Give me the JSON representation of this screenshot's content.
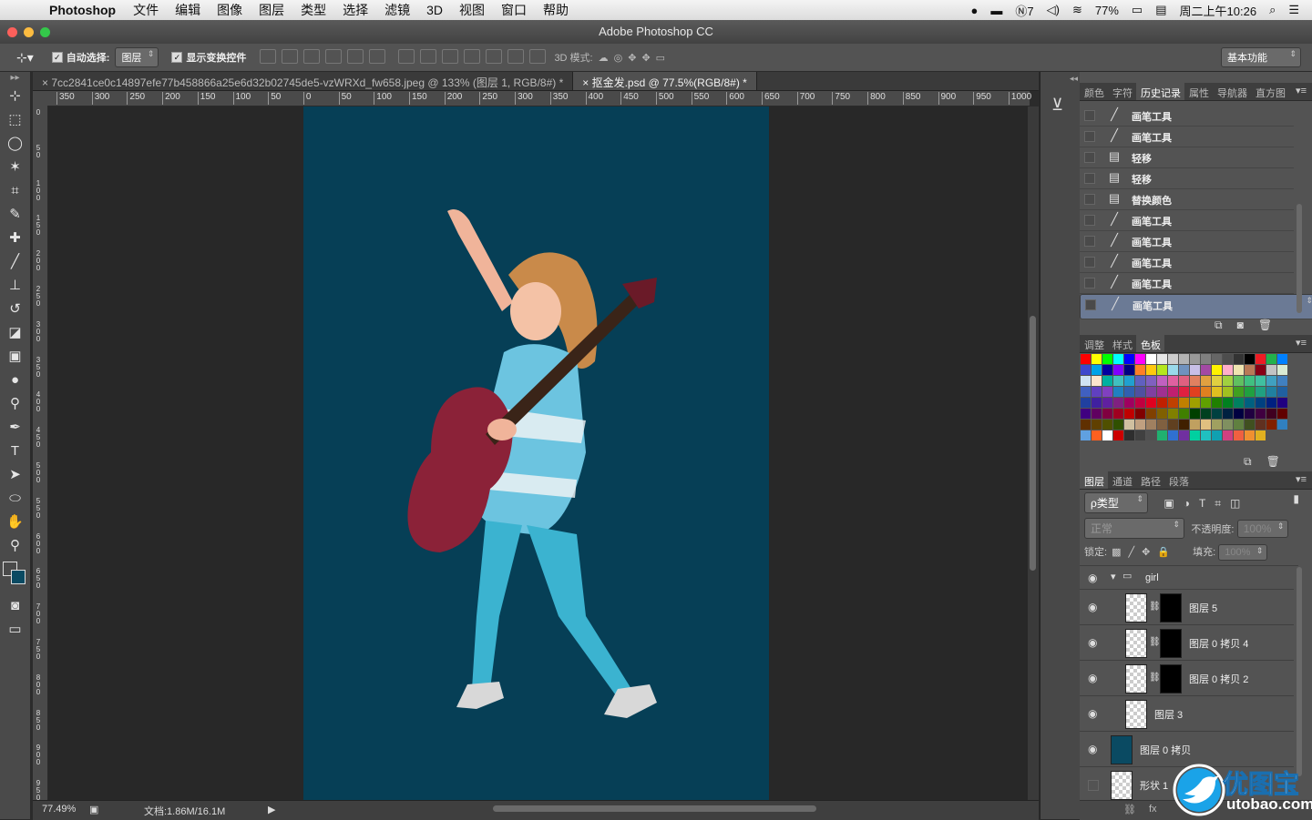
{
  "menubar": {
    "app_name": "Photoshop",
    "items": [
      "文件",
      "编辑",
      "图像",
      "图层",
      "类型",
      "选择",
      "滤镜",
      "3D",
      "视图",
      "窗口",
      "帮助"
    ],
    "status": {
      "input_method": "7",
      "battery": "77%",
      "datetime": "周二上午10:26"
    }
  },
  "window": {
    "title": "Adobe Photoshop CC"
  },
  "options": {
    "auto_select_label": "自动选择:",
    "auto_select_value": "图层",
    "show_transform_label": "显示变换控件",
    "mode_3d_label": "3D 模式:",
    "workspace": "基本功能"
  },
  "tabs": [
    {
      "label": "7cc2841ce0c14897efe77b458866a25e6d32b02745de5-vzWRXd_fw658.jpeg @ 133% (图层 1, RGB/8#) *"
    },
    {
      "label": "抠金发.psd @ 77.5%(RGB/8#) *"
    }
  ],
  "ruler": {
    "h_ticks": [
      "350",
      "300",
      "250",
      "200",
      "150",
      "100",
      "50",
      "0",
      "50",
      "100",
      "150",
      "200",
      "250",
      "300",
      "350",
      "400",
      "450",
      "500",
      "550",
      "600",
      "650",
      "700",
      "750",
      "800",
      "850",
      "900",
      "950",
      "1000"
    ],
    "v_ticks": [
      "0",
      "5\n0",
      "1\n0\n0",
      "1\n5\n0",
      "2\n0\n0",
      "2\n5\n0",
      "3\n0\n0",
      "3\n5\n0",
      "4\n0\n0",
      "4\n5\n0",
      "5\n0\n0",
      "5\n5\n0",
      "6\n0\n0",
      "6\n5\n0",
      "7\n0\n0",
      "7\n5\n0",
      "8\n0\n0",
      "8\n5\n0",
      "9\n0\n0",
      "9\n5\n0"
    ]
  },
  "status": {
    "zoom": "77.49%",
    "doc_size": "文档:1.86M/16.1M"
  },
  "history_panel": {
    "tabs": [
      "颜色",
      "字符",
      "历史记录",
      "属性",
      "导航器",
      "直方图"
    ],
    "active_tab": "历史记录",
    "items": [
      {
        "label": "画笔工具",
        "icon": "brush-icon"
      },
      {
        "label": "画笔工具",
        "icon": "brush-icon"
      },
      {
        "label": "轻移",
        "icon": "document-icon"
      },
      {
        "label": "轻移",
        "icon": "document-icon"
      },
      {
        "label": "替换颜色",
        "icon": "document-icon"
      },
      {
        "label": "画笔工具",
        "icon": "brush-icon"
      },
      {
        "label": "画笔工具",
        "icon": "brush-icon"
      },
      {
        "label": "画笔工具",
        "icon": "brush-icon"
      },
      {
        "label": "画笔工具",
        "icon": "brush-icon"
      },
      {
        "label": "画笔工具",
        "icon": "brush-icon",
        "selected": true
      }
    ]
  },
  "swatches_panel": {
    "tabs": [
      "调整",
      "样式",
      "色板"
    ],
    "active_tab": "色板",
    "colors": [
      "#ff0000",
      "#ffff00",
      "#00ff00",
      "#00ffff",
      "#0000ff",
      "#ff00ff",
      "#ffffff",
      "#e6e6e6",
      "#cccccc",
      "#b3b3b3",
      "#999999",
      "#808080",
      "#666666",
      "#4d4d4d",
      "#333333",
      "#000000",
      "#ed1c24",
      "#22b14c",
      "#0080ff",
      "#3f48cc",
      "#00a2e8",
      "#0000a0",
      "#7f00ff",
      "#000080",
      "#ff7f27",
      "#ffc90e",
      "#b5e61d",
      "#99d9ea",
      "#7092be",
      "#c8bfe7",
      "#a349a4",
      "#fff200",
      "#ffaec9",
      "#efe4b0",
      "#b97a57",
      "#880015",
      "#c3c3c3",
      "#d9ead3",
      "#cfe2f3",
      "#fce5cd",
      "#00b0a0",
      "#40c0c0",
      "#20a0d0",
      "#6060c0",
      "#8060c0",
      "#c060c0",
      "#e060a0",
      "#e06080",
      "#e08060",
      "#e0a040",
      "#e0d040",
      "#a0d040",
      "#60c060",
      "#40c080",
      "#40c0a0",
      "#40a0c0",
      "#4080c0",
      "#4060c0",
      "#6040c0",
      "#8040c0",
      "#2080c0",
      "#3060b0",
      "#5050a0",
      "#8040a0",
      "#a03090",
      "#c02070",
      "#e02040",
      "#e04020",
      "#e08020",
      "#e0c020",
      "#a0c020",
      "#40a020",
      "#20a040",
      "#20a080",
      "#2080a0",
      "#2060a0",
      "#2040a0",
      "#4020a0",
      "#6020a0",
      "#802080",
      "#a00060",
      "#c00040",
      "#e00020",
      "#c02000",
      "#c04000",
      "#c08000",
      "#a0a000",
      "#60a000",
      "#208000",
      "#008020",
      "#008060",
      "#006080",
      "#004080",
      "#002080",
      "#200080",
      "#400080",
      "#600060",
      "#800040",
      "#a00020",
      "#c00000",
      "#800000",
      "#804000",
      "#806000",
      "#808000",
      "#408000",
      "#004000",
      "#004020",
      "#004040",
      "#002040",
      "#000040",
      "#200040",
      "#400040",
      "#400020",
      "#600000",
      "#603000",
      "#604000",
      "#505000",
      "#305000",
      "#d0c0a0",
      "#c0a080",
      "#a08060",
      "#806040",
      "#604020",
      "#402000",
      "#c0a060",
      "#e0c080",
      "#a0a060",
      "#809060",
      "#608040",
      "#405020",
      "#603020",
      "#802000",
      "#3080c0",
      "#60a0e0",
      "#ff6020",
      "#ffffff",
      "#cc0000",
      "#2e2e2e",
      "#404040",
      "#505050",
      "#20b070",
      "#3070d0",
      "#7030a0",
      "#00d0a0",
      "#20c0c0",
      "#10a0b0",
      "#d04080",
      "#f06040",
      "#f09030",
      "#e0b020"
    ]
  },
  "layers_panel": {
    "tabs": [
      "图层",
      "通道",
      "路径",
      "段落"
    ],
    "active_tab": "图层",
    "filter": "ρ类型",
    "blend_mode": "正常",
    "opacity_label": "不透明度:",
    "opacity": "100%",
    "lock_label": "锁定:",
    "fill_label": "填充:",
    "fill": "100%",
    "layers": [
      {
        "name": "girl",
        "type": "group"
      },
      {
        "name": "图层 5",
        "type": "masked"
      },
      {
        "name": "图层 0 拷贝 4",
        "type": "masked"
      },
      {
        "name": "图层 0 拷贝 2",
        "type": "masked"
      },
      {
        "name": "图层 3",
        "type": "plain"
      },
      {
        "name": "图层 0 拷贝",
        "type": "fill",
        "color": "#0a4a62"
      },
      {
        "name": "形状 1",
        "type": "shape"
      }
    ]
  },
  "watermark": {
    "cn": "优图宝",
    "url": "utobao.com"
  },
  "colors": {
    "canvas_bg": "#063f56",
    "workspace": "#282828",
    "panel": "#535353",
    "selected_row": "#6b7a95"
  }
}
